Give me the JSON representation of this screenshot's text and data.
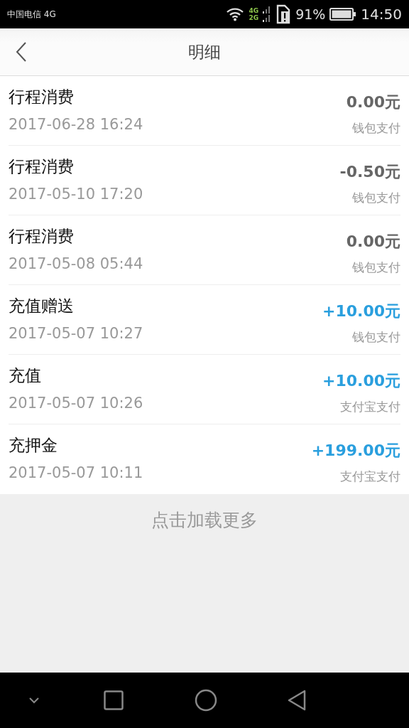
{
  "status_bar": {
    "carrier": "中国电信 4G",
    "network_top": "4G",
    "network_bottom": "2G",
    "battery": "91%",
    "time": "14:50"
  },
  "header": {
    "title": "明细"
  },
  "records": [
    {
      "title": "行程消费",
      "time": "2017-06-28 16:24",
      "amount": "0.00元",
      "method": "钱包支付",
      "kind": "expense"
    },
    {
      "title": "行程消费",
      "time": "2017-05-10 17:20",
      "amount": "-0.50元",
      "method": "钱包支付",
      "kind": "expense"
    },
    {
      "title": "行程消费",
      "time": "2017-05-08 05:44",
      "amount": "0.00元",
      "method": "钱包支付",
      "kind": "expense"
    },
    {
      "title": "充值赠送",
      "time": "2017-05-07 10:27",
      "amount": "+10.00元",
      "method": "钱包支付",
      "kind": "income"
    },
    {
      "title": "充值",
      "time": "2017-05-07 10:26",
      "amount": "+10.00元",
      "method": "支付宝支付",
      "kind": "income"
    },
    {
      "title": "充押金",
      "time": "2017-05-07 10:11",
      "amount": "+199.00元",
      "method": "支付宝支付",
      "kind": "income"
    }
  ],
  "load_more": "点击加载更多"
}
